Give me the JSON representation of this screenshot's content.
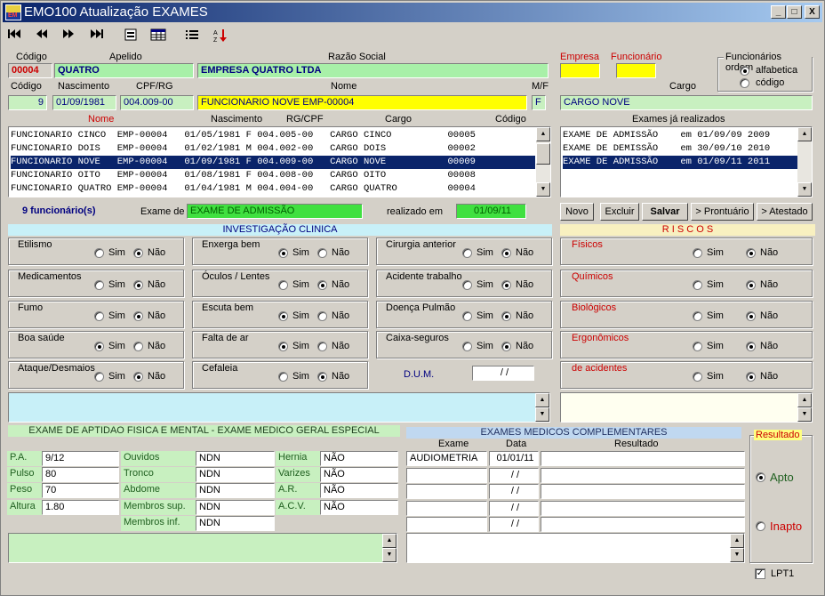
{
  "window": {
    "title": "EMO100  Atualização EXAMES",
    "icon_text": "EM"
  },
  "titlebar_buttons": [
    "_",
    "□",
    "X"
  ],
  "toolbar": [
    "first-record-icon",
    "prev-record-icon",
    "next-record-icon",
    "last-record-icon",
    "form-view-icon",
    "table-view-icon",
    "list-icon",
    "sort-az-icon"
  ],
  "header": {
    "codigo_label": "Código",
    "codigo_value": "00004",
    "apelido_label": "Apelido",
    "apelido_value": "QUATRO",
    "razao_label": "Razão Social",
    "razao_value": "EMPRESA QUATRO LTDA",
    "empresa_label": "Empresa",
    "funcionario_label": "Funcionário",
    "ordem_label": "Funcionários ordem",
    "ordem_opt1": "alfabetica",
    "ordem_opt2": "código",
    "emp_codigo_label": "Código",
    "emp_codigo_value": "9",
    "nasc_label": "Nascimento",
    "nasc_value": "01/09/1981",
    "cpf_label": "CPF/RG",
    "cpf_value": "004.009-00",
    "nome_label": "Nome",
    "nome_value": "FUNCIONARIO NOVE   EMP-00004",
    "mf_label": "M/F",
    "mf_value": "F",
    "cargo_label": "Cargo",
    "cargo_value": "CARGO NOVE"
  },
  "emp_list": {
    "col_nome": "Nome",
    "col_nasc": "Nascimento",
    "col_rg": "RG/CPF",
    "col_cargo": "Cargo",
    "col_codigo": "Código",
    "rows": [
      "FUNCIONARIO CINCO  EMP-00004   01/05/1981 F 004.005-00   CARGO CINCO          00005",
      "FUNCIONARIO DOIS   EMP-00004   01/02/1981 M 004.002-00   CARGO DOIS           00002",
      "FUNCIONARIO NOVE   EMP-00004   01/09/1981 F 004.009-00   CARGO NOVE           00009",
      "FUNCIONARIO OITO   EMP-00004   01/08/1981 F 004.008-00   CARGO OITO           00008",
      "FUNCIONARIO QUATRO EMP-00004   01/04/1981 M 004.004-00   CARGO QUATRO         00004"
    ],
    "selected": 2
  },
  "exames_realizados": {
    "label": "Exames já realizados",
    "rows": [
      "EXAME DE ADMISSÃO    em 01/09/09 2009",
      "EXAME DE DEMISSÃO    em 30/09/10 2010",
      "EXAME DE ADMISSÃO    em 01/09/11 2011"
    ],
    "selected": 2
  },
  "status": {
    "count": "9  funcionário(s)",
    "exame_de_label": "Exame de",
    "exame_de_value": "EXAME DE ADMISSÃO",
    "realizado_label": "realizado em",
    "realizado_value": "01/09/11"
  },
  "buttons": {
    "novo": "Novo",
    "excluir": "Excluir",
    "salvar": "Salvar",
    "prontuario": "> Prontuário",
    "atestado": "> Atestado"
  },
  "clinica": {
    "title": "INVESTIGAÇÃO CLINICA",
    "sim": "Sim",
    "nao": "Não",
    "items": [
      {
        "label": "Etilismo",
        "value": "nao"
      },
      {
        "label": "Medicamentos",
        "value": "nao"
      },
      {
        "label": "Fumo",
        "value": "nao"
      },
      {
        "label": "Boa saúde",
        "value": "sim"
      },
      {
        "label": "Ataque/Desmaios",
        "value": "nao"
      },
      {
        "label": "Enxerga bem",
        "value": "sim"
      },
      {
        "label": "Óculos / Lentes",
        "value": "nao"
      },
      {
        "label": "Escuta bem",
        "value": "sim"
      },
      {
        "label": "Falta de ar",
        "value": "sim"
      },
      {
        "label": "Cefaleia",
        "value": "nao"
      },
      {
        "label": "Cirurgia anterior",
        "value": "nao"
      },
      {
        "label": "Acidente trabalho",
        "value": "nao"
      },
      {
        "label": "Doença Pulmão",
        "value": "nao"
      },
      {
        "label": "Caixa-seguros",
        "value": "nao"
      }
    ],
    "dum_label": "D.U.M.",
    "dum_value": " / /"
  },
  "riscos": {
    "title": "R I S C O S",
    "items": [
      {
        "label": "Físicos",
        "value": "nao"
      },
      {
        "label": "Químicos",
        "value": "nao"
      },
      {
        "label": "Biológicos",
        "value": "nao"
      },
      {
        "label": "Ergonômicos",
        "value": "nao"
      },
      {
        "label": "de acidentes",
        "value": "nao"
      }
    ]
  },
  "aptidao": {
    "title": "EXAME DE APTIDAO FISICA E MENTAL - EXAME MEDICO GERAL ESPECIAL",
    "col1": [
      {
        "label": "P.A.",
        "value": "9/12"
      },
      {
        "label": "Pulso",
        "value": "80"
      },
      {
        "label": "Peso",
        "value": "70"
      },
      {
        "label": "Altura",
        "value": "1.80"
      }
    ],
    "col2": [
      {
        "label": "Ouvidos",
        "value": "NDN"
      },
      {
        "label": "Tronco",
        "value": "NDN"
      },
      {
        "label": "Abdome",
        "value": "NDN"
      },
      {
        "label": "Membros sup.",
        "value": "NDN"
      },
      {
        "label": "Membros inf.",
        "value": "NDN"
      }
    ],
    "col3": [
      {
        "label": "Hernia",
        "value": "NÃO"
      },
      {
        "label": "Varizes",
        "value": "NÃO"
      },
      {
        "label": "A.R.",
        "value": "NÃO"
      },
      {
        "label": "A.C.V.",
        "value": "NÃO"
      }
    ]
  },
  "complementares": {
    "title": "EXAMES MEDICOS COMPLEMENTARES",
    "col_exame": "Exame",
    "col_data": "Data",
    "col_resultado": "Resultado",
    "rows": [
      {
        "exame": "AUDIOMETRIA",
        "data": "01/01/11",
        "resultado": ""
      },
      {
        "exame": "",
        "data": " / /",
        "resultado": ""
      },
      {
        "exame": "",
        "data": " / /",
        "resultado": ""
      },
      {
        "exame": "",
        "data": " / /",
        "resultado": ""
      },
      {
        "exame": "",
        "data": " / /",
        "resultado": ""
      }
    ]
  },
  "resultado": {
    "label": "Resultado",
    "apto": "Apto",
    "inapto": "Inapto",
    "value": "apto"
  },
  "lpt1": "LPT1"
}
